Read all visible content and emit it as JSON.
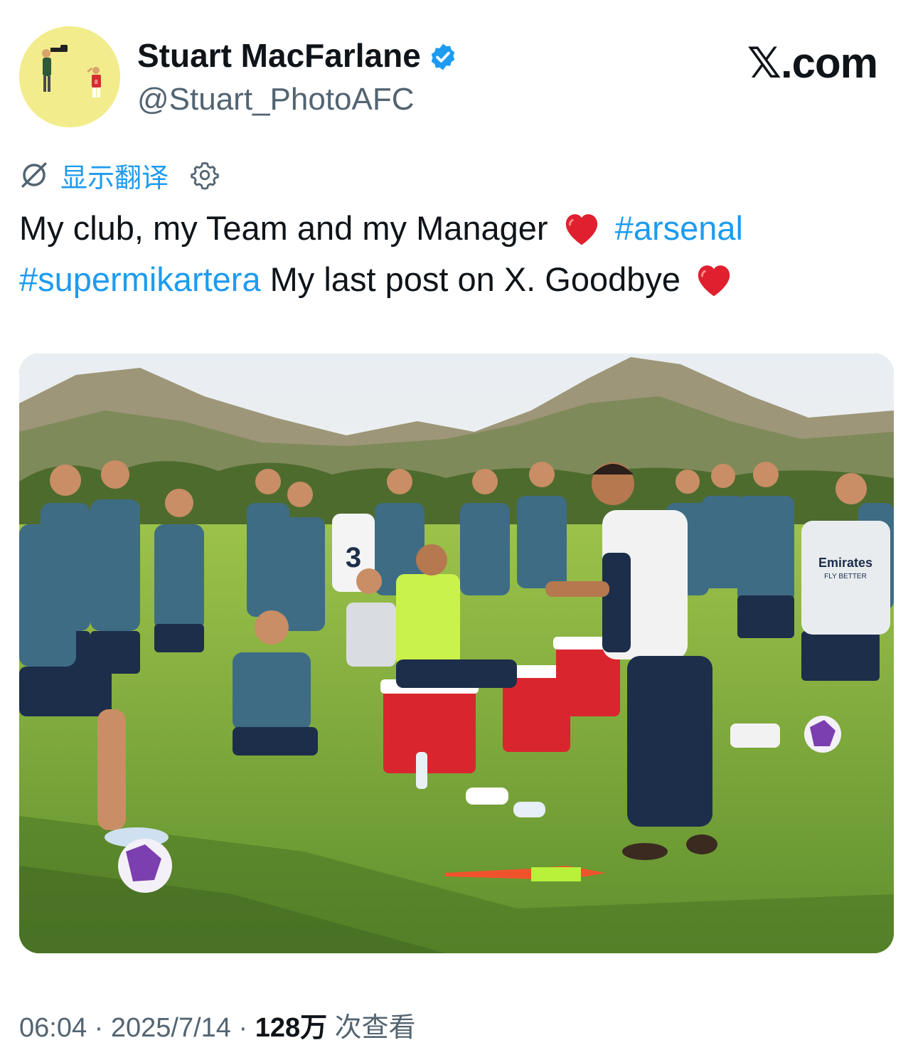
{
  "author": {
    "display_name": "Stuart MacFarlane",
    "handle": "@Stuart_PhotoAFC",
    "verified_icon": "verified-badge-icon",
    "avatar_bg": "#f2ec8c"
  },
  "brand": {
    "label": "𝕏.com"
  },
  "translate": {
    "label": "显示翻译",
    "icon": "no-translate-icon",
    "settings_icon": "gear-icon"
  },
  "tweet": {
    "part1": "My club, my Team and my Manager",
    "tag1": "#arsenal",
    "tag2": "#supermikartera",
    "part2": "My last post on X. Goodbye"
  },
  "media": {
    "description_alt": "",
    "shirt_text": "Emirates",
    "shirt_subtext": "FLY BETTER",
    "bib_number": "3"
  },
  "meta": {
    "time": "06:04",
    "sep1": " · ",
    "date": "2025/7/14",
    "sep2": " · ",
    "views_count": "128万",
    "views_label": " 次查看"
  },
  "colors": {
    "link": "#1d9bf0",
    "muted": "#536471",
    "text": "#0f1419",
    "heart": "#e0202e"
  }
}
